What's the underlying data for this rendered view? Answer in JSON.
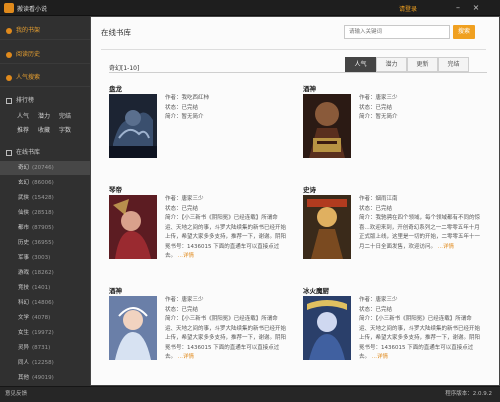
{
  "titlebar": {
    "app_title": "搬读看小说",
    "login_label": "请登录",
    "min": "–",
    "close": "×"
  },
  "sidebar": {
    "nav": [
      {
        "label": "我的书架"
      },
      {
        "label": "阅读历史"
      },
      {
        "label": "人气搜索"
      }
    ],
    "rank_head": "排行榜",
    "rank_links": [
      "人气",
      "潜力",
      "完结",
      "推荐",
      "收藏",
      "字数"
    ],
    "online_head": "在线书库",
    "categories": [
      {
        "name": "奇幻",
        "count": "(20746)"
      },
      {
        "name": "玄幻",
        "count": "(86006)"
      },
      {
        "name": "武侠",
        "count": "(15428)"
      },
      {
        "name": "仙侠",
        "count": "(28518)"
      },
      {
        "name": "都市",
        "count": "(87905)"
      },
      {
        "name": "历史",
        "count": "(36955)"
      },
      {
        "name": "军事",
        "count": "(3003)"
      },
      {
        "name": "游戏",
        "count": "(18262)"
      },
      {
        "name": "竞技",
        "count": "(1401)"
      },
      {
        "name": "科幻",
        "count": "(14806)"
      },
      {
        "name": "文学",
        "count": "(4078)"
      },
      {
        "name": "女生",
        "count": "(19972)"
      },
      {
        "name": "灵异",
        "count": "(8731)"
      },
      {
        "name": "同人",
        "count": "(12258)"
      },
      {
        "name": "其他",
        "count": "(49019)"
      }
    ]
  },
  "main": {
    "title": "在线书库",
    "search_placeholder": "请输入关键词",
    "search_button": "搜索",
    "sub_category": "奇幻[1-10]",
    "tabs": [
      "人气",
      "潜力",
      "更新",
      "完结"
    ],
    "labels": {
      "author": "作者：",
      "status": "状态：",
      "summary": "简介：",
      "more": "...详情"
    },
    "books": [
      {
        "title": "盘龙",
        "author": "我吃西红柿",
        "status": "已完结",
        "summary": "暂无简介",
        "long": false
      },
      {
        "title": "酒神",
        "author": "唐家三少",
        "status": "已完结",
        "summary": "暂无简介",
        "long": false
      },
      {
        "title": "琴帝",
        "author": "唐家三少",
        "status": "已完结",
        "summary": "【小三新书《阴阳冕》已经连载】所谓命运、天地之间的事，斗罗大陆续集的新书已经开始上传，希望大家多多支持，推荐一下，谢谢。阴阳冕书号：1436015 下面的直通车可以直接点过去。",
        "long": true
      },
      {
        "title": "史诗",
        "author": "烟雨江南",
        "status": "已完结",
        "summary": "我驰骋在四个领域，每个领域都有不同的惊喜...欢迎来到，开创奇幻系列之一二零零五年十月正式版上线，这里是一切的开始，二零零五年十一月二十日全面发售，欢迎访问。",
        "long": true
      },
      {
        "title": "酒神",
        "author": "唐家三少",
        "status": "已完结",
        "summary": "【小三新书《阴阳冕》已经连载】所谓命运、天地之间的事，斗罗大陆续集的新书已经开始上传，希望大家多多支持，推荐一下，谢谢。阴阳冕书号：1436015 下面的直通车可以直接点过去。",
        "long": true
      },
      {
        "title": "冰火魔厨",
        "author": "唐家三少",
        "status": "已完结",
        "summary": "【小三新书《阴阳冕》已经连载】所谓命运、天地之间的事，斗罗大陆续集的新书已经开始上传，希望大家多多支持，推荐一下，谢谢。阴阳冕书号：1436015 下面的直通车可以直接点过去。",
        "long": true
      }
    ]
  },
  "status": {
    "left": "意见反馈",
    "right": "程序版本：2.0.9.2"
  }
}
